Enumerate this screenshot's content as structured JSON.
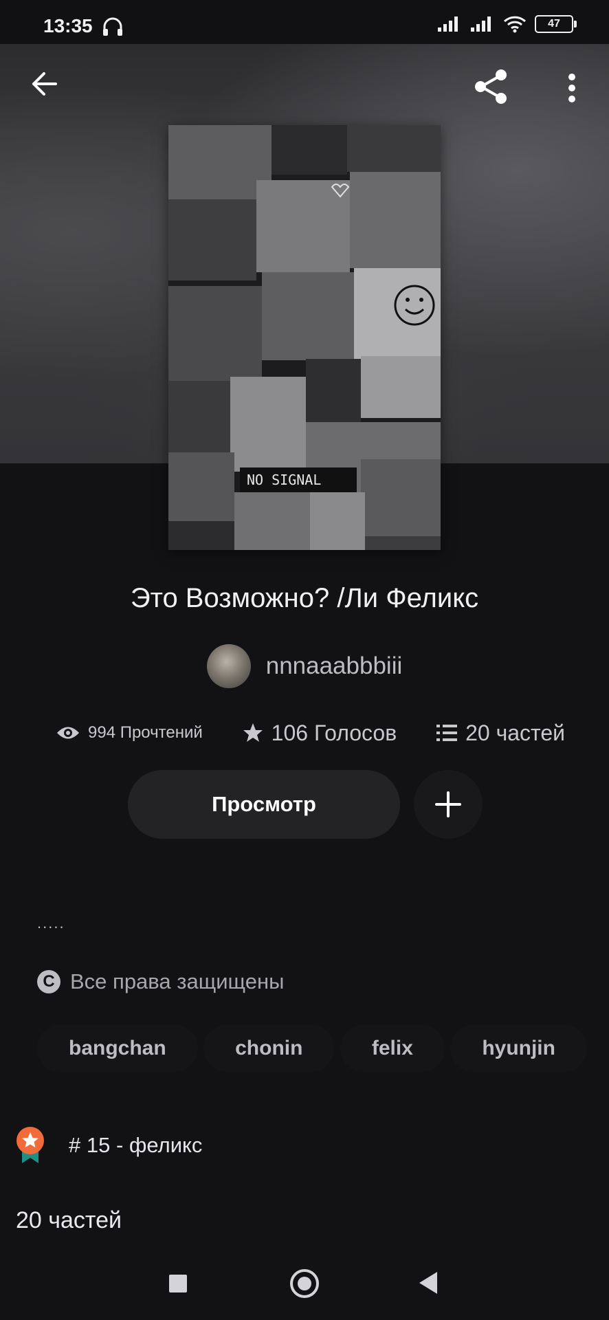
{
  "status_bar": {
    "time": "13:35",
    "battery": "47"
  },
  "story": {
    "title": "Это Возможно? /Ли Феликс",
    "author": "nnnaaabbbiii",
    "cover_overlay_text": "NO SIGNAL",
    "stats": {
      "reads": "994 Прочтений",
      "votes": "106 Голосов",
      "parts": "20 частей"
    },
    "view_button": "Просмотр",
    "description": ".....",
    "copyright": "Все права защищены",
    "tags": [
      "bangchan",
      "chonin",
      "felix",
      "hyunjin"
    ],
    "rank": "# 15 - феликс",
    "parts_header": "20 частей"
  },
  "colors": {
    "background": "#121114",
    "rank_badge": "#f26b3a",
    "rank_ribbon": "#1f8f86"
  },
  "icons": {
    "back": "arrow-left-icon",
    "share": "share-icon",
    "more": "more-vertical-icon",
    "reads": "eye-icon",
    "votes": "star-icon",
    "parts": "list-icon",
    "add": "plus-icon",
    "copyright": "copyright-icon",
    "rank": "award-icon"
  }
}
